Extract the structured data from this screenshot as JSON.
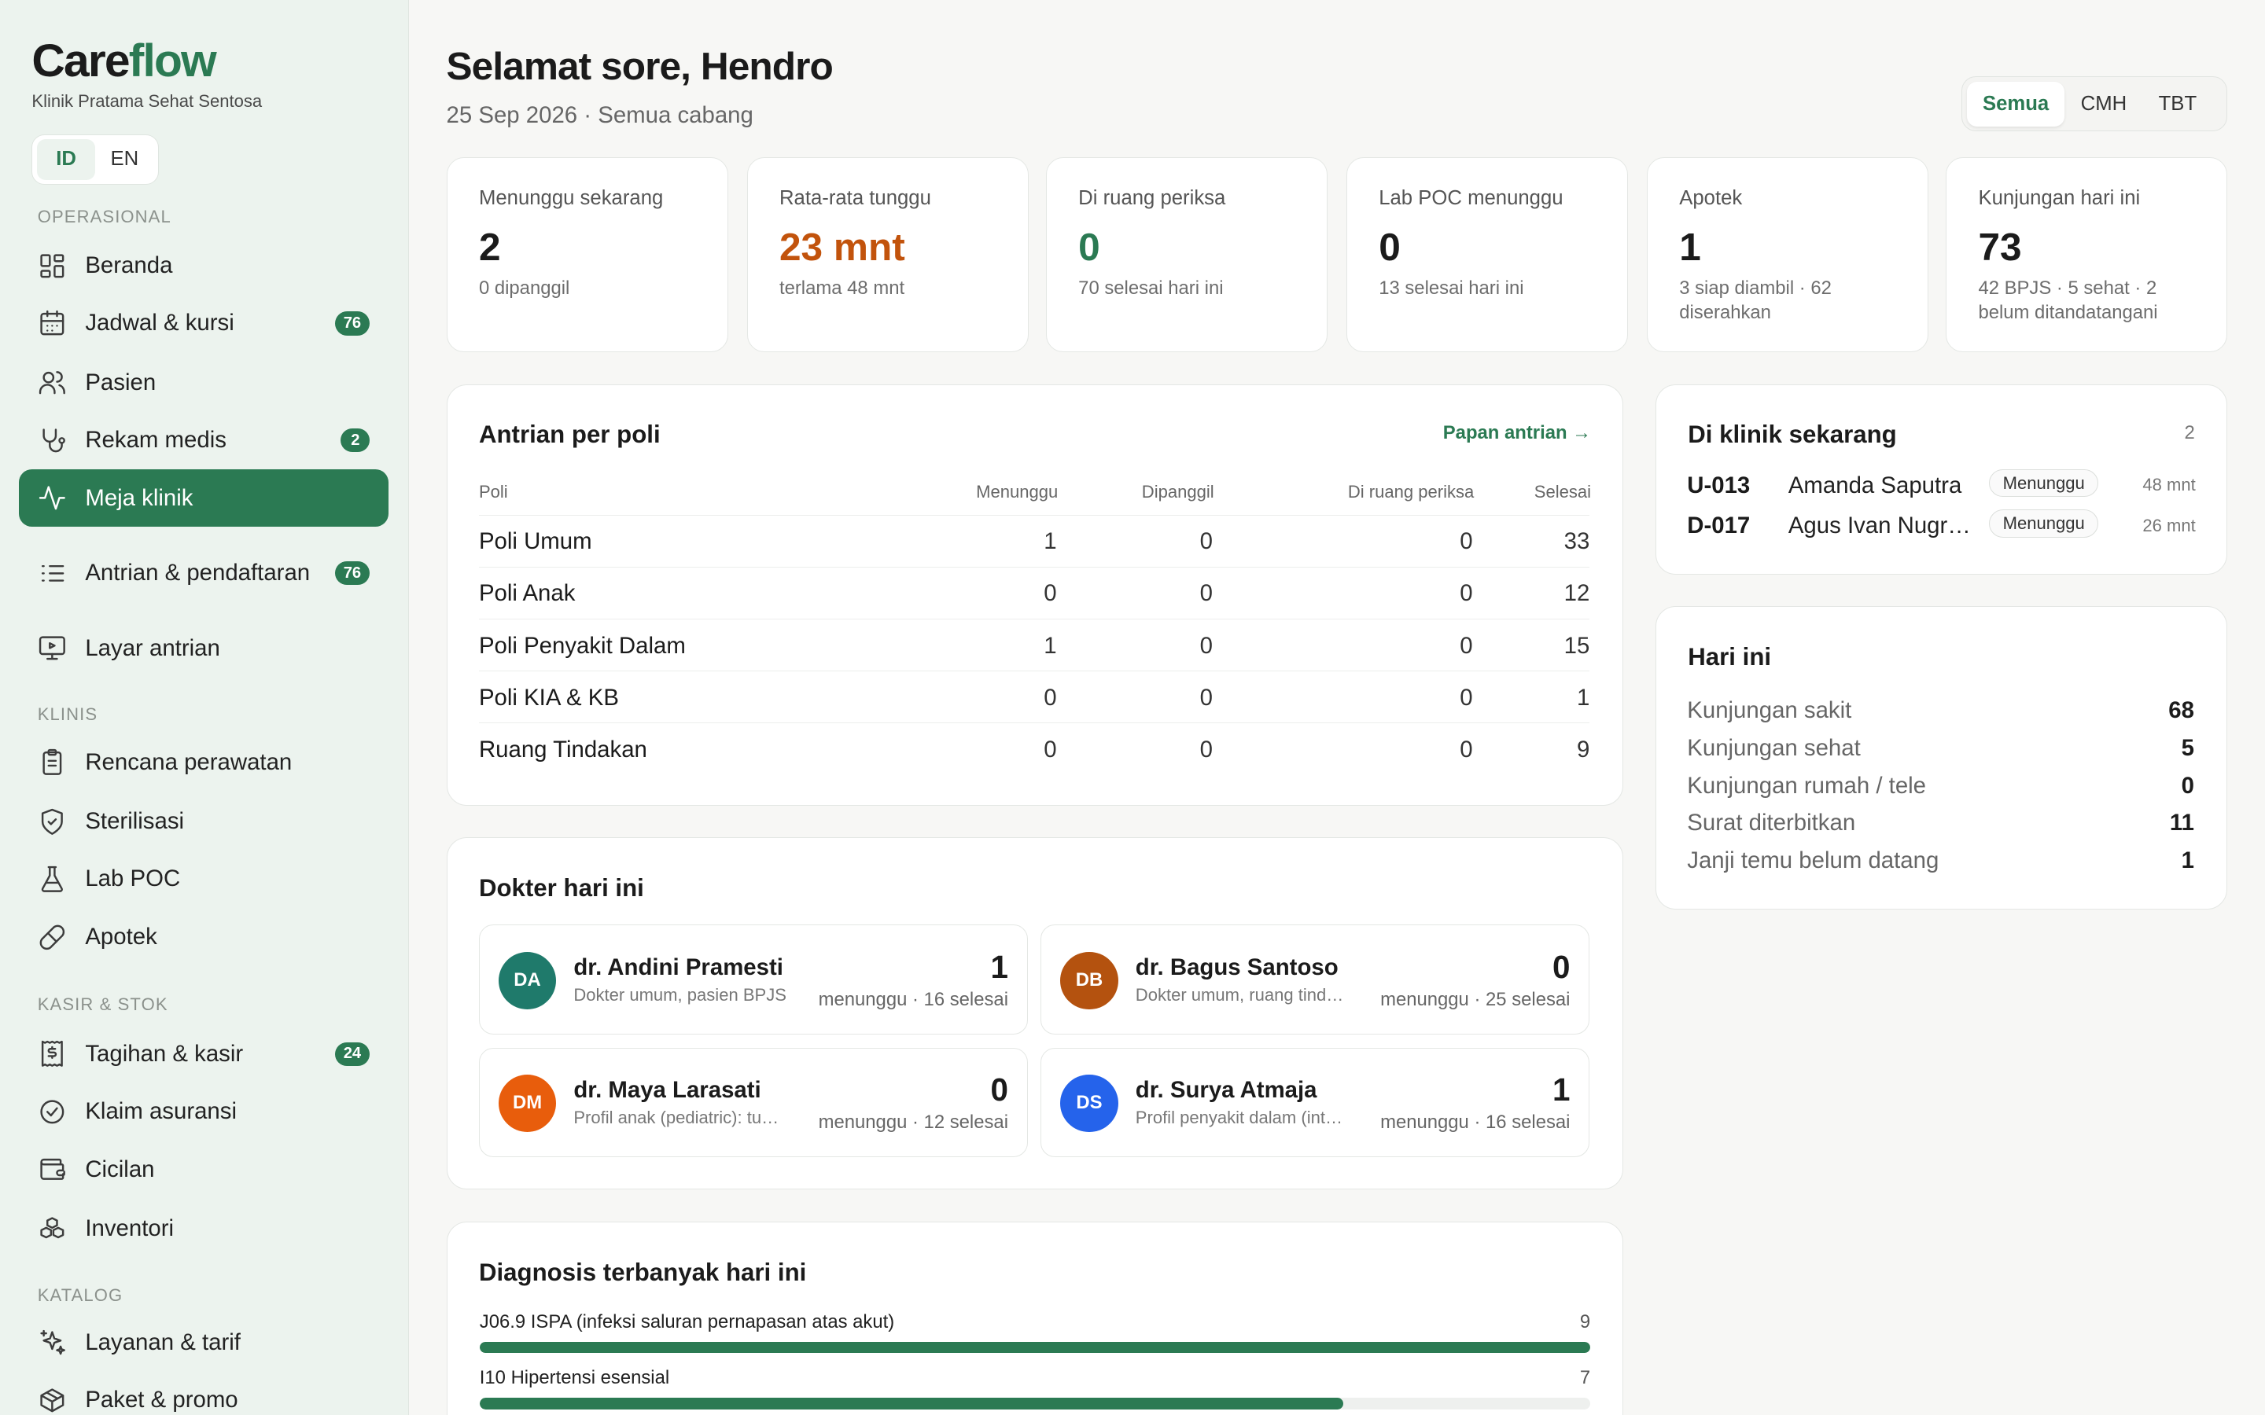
{
  "brand": {
    "name_a": "Care",
    "name_b": "flow",
    "clinic": "Klinik Pratama Sehat Sentosa"
  },
  "lang": {
    "id": "ID",
    "en": "EN",
    "active": "ID"
  },
  "sidebar": {
    "sections": [
      "OPERASIONAL",
      "KLINIS",
      "KASIR & STOK",
      "KATALOG"
    ],
    "items": [
      {
        "label": "Beranda",
        "icon": "grid-icon"
      },
      {
        "label": "Jadwal & kursi",
        "icon": "calendar-icon",
        "badge": "76"
      },
      {
        "label": "Pasien",
        "icon": "users-icon"
      },
      {
        "label": "Rekam medis",
        "icon": "stethoscope-icon",
        "badge": "2"
      },
      {
        "label": "Meja klinik",
        "icon": "activity-icon",
        "active": true
      },
      {
        "label": "Antrian & pendaftaran",
        "icon": "list-icon",
        "badge": "76"
      },
      {
        "label": "Layar antrian",
        "icon": "monitor-icon"
      },
      {
        "label": "Rencana perawatan",
        "icon": "clipboard-icon"
      },
      {
        "label": "Sterilisasi",
        "icon": "shield-icon"
      },
      {
        "label": "Lab POC",
        "icon": "flask-icon"
      },
      {
        "label": "Apotek",
        "icon": "pill-icon"
      },
      {
        "label": "Tagihan & kasir",
        "icon": "receipt-icon",
        "badge": "24"
      },
      {
        "label": "Klaim asuransi",
        "icon": "check-circle-icon"
      },
      {
        "label": "Cicilan",
        "icon": "wallet-icon"
      },
      {
        "label": "Inventori",
        "icon": "boxes-icon"
      },
      {
        "label": "Layanan & tarif",
        "icon": "sparkles-icon"
      },
      {
        "label": "Paket & promo",
        "icon": "package-icon"
      }
    ]
  },
  "header": {
    "greeting": "Selamat sore, Hendro",
    "subtitle": "25 Sep 2026 · Semua cabang",
    "branches": [
      "Semua",
      "CMH",
      "TBT"
    ],
    "active_branch": "Semua"
  },
  "stats": [
    {
      "title": "Menunggu sekarang",
      "value": "2",
      "sub": "0 dipanggil"
    },
    {
      "title": "Rata-rata tunggu",
      "value": "23 mnt",
      "sub": "terlama 48 mnt",
      "color": "#c2530c"
    },
    {
      "title": "Di ruang periksa",
      "value": "0",
      "sub": "70 selesai hari ini",
      "color": "#2b7a53"
    },
    {
      "title": "Lab POC menunggu",
      "value": "0",
      "sub": "13 selesai hari ini"
    },
    {
      "title": "Apotek",
      "value": "1",
      "sub": "3 siap diambil · 62 diserahkan"
    },
    {
      "title": "Kunjungan hari ini",
      "value": "73",
      "sub": "42 BPJS · 5 sehat · 2 belum ditandatangani"
    }
  ],
  "queue": {
    "title": "Antrian per poli",
    "link": "Papan antrian →",
    "columns": [
      "Poli",
      "Menunggu",
      "Dipanggil",
      "Di ruang periksa",
      "Selesai"
    ],
    "rows": [
      [
        "Poli Umum",
        "1",
        "0",
        "0",
        "33"
      ],
      [
        "Poli Anak",
        "0",
        "0",
        "0",
        "12"
      ],
      [
        "Poli Penyakit Dalam",
        "1",
        "0",
        "0",
        "15"
      ],
      [
        "Poli KIA & KB",
        "0",
        "0",
        "0",
        "1"
      ],
      [
        "Ruang Tindakan",
        "0",
        "0",
        "0",
        "9"
      ]
    ]
  },
  "doctors": {
    "title": "Dokter hari ini",
    "items": [
      {
        "initials": "DA",
        "name": "dr. Andini Pramesti",
        "desc": "Dokter umum, pasien BPJS",
        "count": "1",
        "sub": "menunggu · 16 selesai",
        "color": "#1f7a6b"
      },
      {
        "initials": "DB",
        "name": "dr. Bagus Santoso",
        "desc": "Dokter umum, ruang tindakan",
        "count": "0",
        "sub": "menunggu · 25 selesai",
        "color": "#b4520f"
      },
      {
        "initials": "DM",
        "name": "dr. Maya Larasati",
        "desc": "Profil anak (pediatric): tumbuh kembang",
        "count": "0",
        "sub": "menunggu · 12 selesai",
        "color": "#e85d0c"
      },
      {
        "initials": "DS",
        "name": "dr. Surya Atmaja",
        "desc": "Profil penyakit dalam (interna)",
        "count": "1",
        "sub": "menunggu · 16 selesai",
        "color": "#2563eb"
      }
    ]
  },
  "diagnosis": {
    "title": "Diagnosis terbanyak hari ini",
    "items": [
      {
        "label": "J06.9 ISPA (infeksi saluran pernapasan atas akut)",
        "value": 9,
        "max": 9
      },
      {
        "label": "I10 Hipertensi esensial",
        "value": 7,
        "max": 9
      }
    ]
  },
  "in_clinic": {
    "title": "Di klinik sekarang",
    "count": "2",
    "rows": [
      {
        "code": "U-013",
        "name": "Amanda Saputra",
        "status": "Menunggu",
        "time": "48 mnt"
      },
      {
        "code": "D-017",
        "name": "Agus Ivan Nugroho",
        "status": "Menunggu",
        "time": "26 mnt"
      }
    ]
  },
  "today": {
    "title": "Hari ini",
    "rows": [
      {
        "k": "Kunjungan sakit",
        "v": "68"
      },
      {
        "k": "Kunjungan sehat",
        "v": "5"
      },
      {
        "k": "Kunjungan rumah / tele",
        "v": "0"
      },
      {
        "k": "Surat diterbitkan",
        "v": "11"
      },
      {
        "k": "Janji temu belum datang",
        "v": "1"
      }
    ]
  }
}
